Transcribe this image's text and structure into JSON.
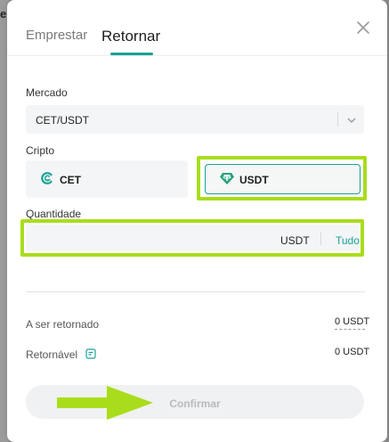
{
  "tabs": [
    {
      "label": "Emprestar",
      "active": false
    },
    {
      "label": "Retornar",
      "active": true
    }
  ],
  "market": {
    "label": "Mercado",
    "value": "CET/USDT"
  },
  "crypto": {
    "label": "Cripto",
    "options": [
      {
        "label": "CET",
        "selected": false
      },
      {
        "label": "USDT",
        "selected": true
      }
    ]
  },
  "quantity": {
    "label": "Quantidade",
    "value": "",
    "unit": "USDT",
    "all_label": "Tudo"
  },
  "summary": {
    "to_return_label": "A ser retornado",
    "to_return_value": "0 USDT",
    "returnable_label": "Retornável",
    "returnable_value": "0 USDT"
  },
  "confirm_label": "Confirmar",
  "colors": {
    "accent": "#1aa196",
    "highlight": "#a9dd1c"
  },
  "icons": {
    "close": "close-icon",
    "chevron": "chevron-down-icon",
    "info": "info-icon"
  }
}
